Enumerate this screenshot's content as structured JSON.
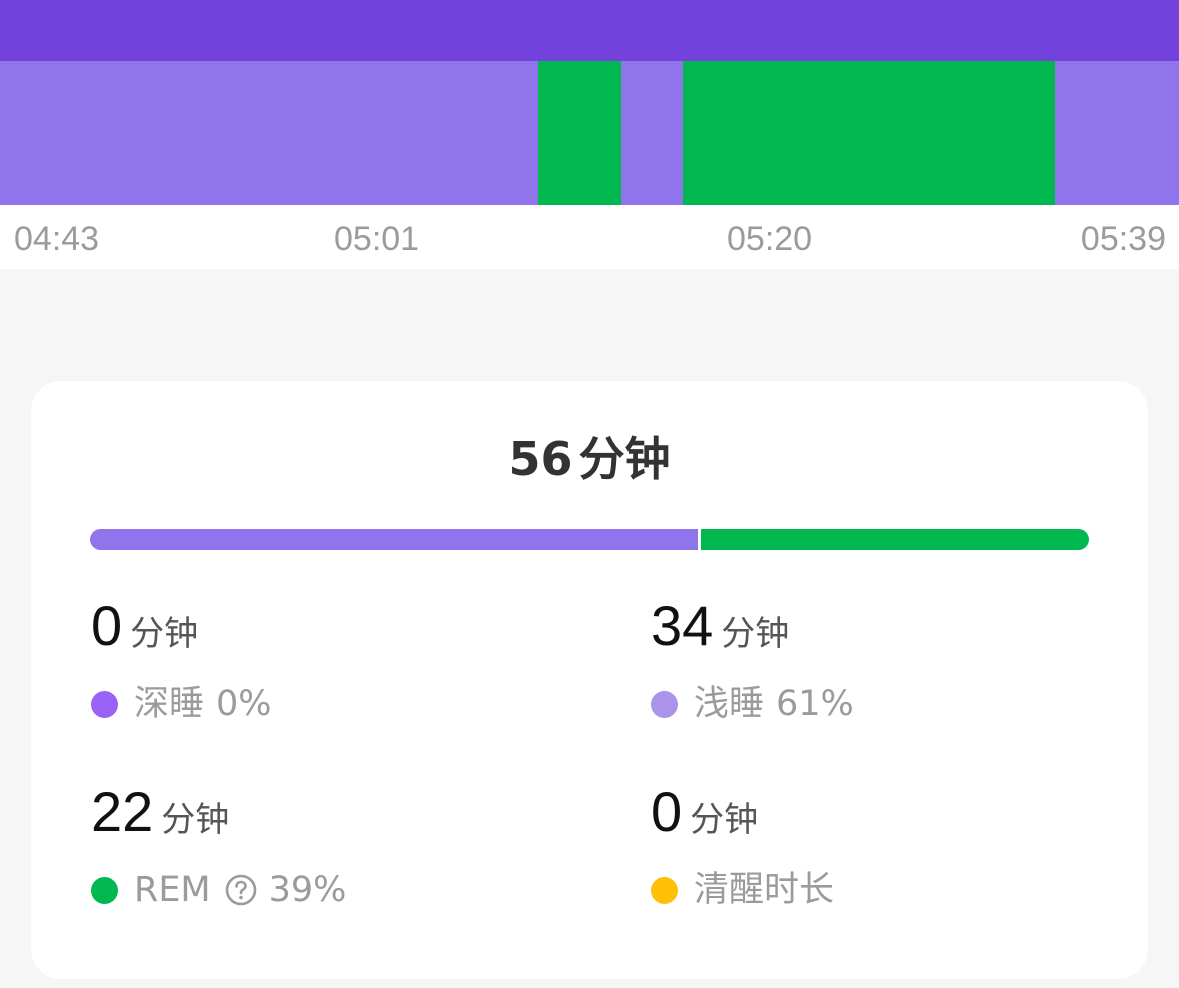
{
  "timeline": {
    "colors": {
      "band": "#7341db",
      "light": "#8f74ec",
      "rem": "#00b84f"
    },
    "time_labels": [
      "04:43",
      "05:01",
      "05:20",
      "05:39"
    ]
  },
  "summary": {
    "total_value": "56",
    "total_unit": "分钟",
    "ratio": {
      "light_fraction": 0.61,
      "rem_fraction": 0.39
    },
    "stats": [
      {
        "value": "0",
        "unit": "分钟",
        "label": "深睡",
        "percent": "0%",
        "dot_color": "#9b63f5"
      },
      {
        "value": "34",
        "unit": "分钟",
        "label": "浅睡",
        "percent": "61%",
        "dot_color": "#ab93ea"
      },
      {
        "value": "22",
        "unit": "分钟",
        "label": "REM",
        "percent": "39%",
        "dot_color": "#00b84f",
        "icon": "help-icon"
      },
      {
        "value": "0",
        "unit": "分钟",
        "label": "清醒时长",
        "percent": "",
        "dot_color": "#ffc107"
      }
    ]
  }
}
